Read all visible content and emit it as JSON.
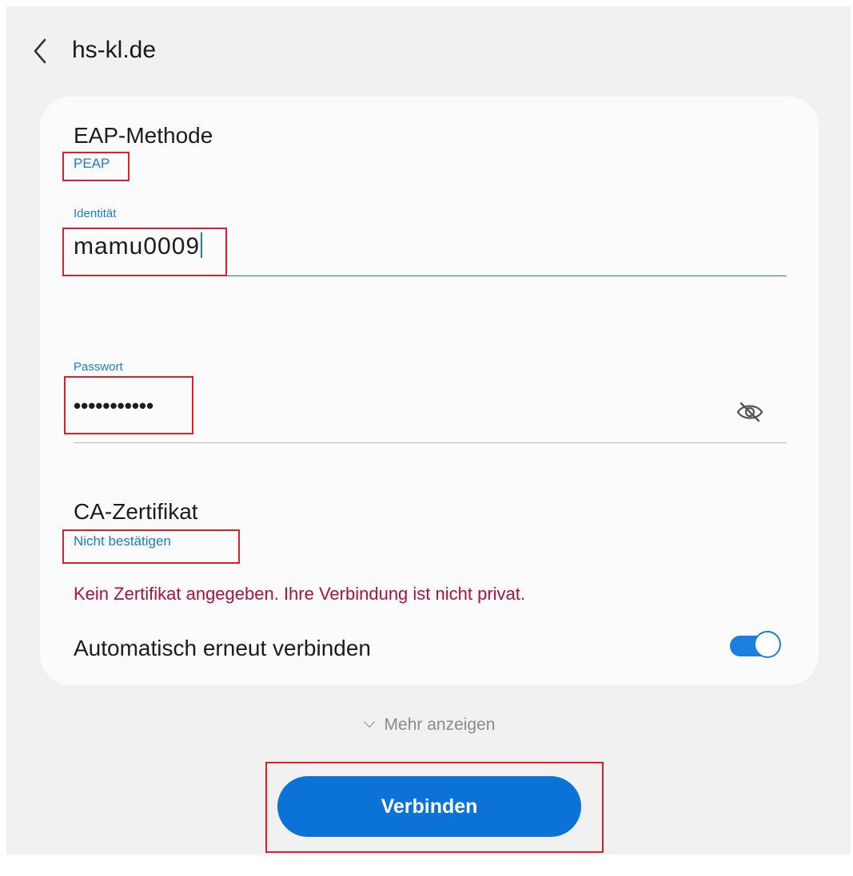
{
  "header": {
    "title": "hs-kl.de",
    "back_icon": "chevron-left-icon"
  },
  "eap": {
    "title": "EAP-Methode",
    "value": "PEAP"
  },
  "identity": {
    "label": "Identität",
    "value": "mamu0009"
  },
  "password": {
    "label": "Passwort",
    "value": "•••••••••••",
    "visibility_icon": "eye-off-icon"
  },
  "ca_certificate": {
    "title": "CA-Zertifikat",
    "value": "Nicht bestätigen",
    "warning": "Kein Zertifikat angegeben. Ihre Verbindung ist nicht privat."
  },
  "auto_reconnect": {
    "label": "Automatisch erneut verbinden",
    "enabled": true
  },
  "more": {
    "label": "Mehr anzeigen",
    "icon": "chevron-down-icon"
  },
  "connect_button": {
    "label": "Verbinden"
  },
  "colors": {
    "accent": "#1a7fbf",
    "primary_button": "#0b72d8",
    "warning": "#a5153f",
    "highlight_box": "#d9202e",
    "card_background": "#fbfbfb",
    "screen_background": "#f1f1f1"
  }
}
